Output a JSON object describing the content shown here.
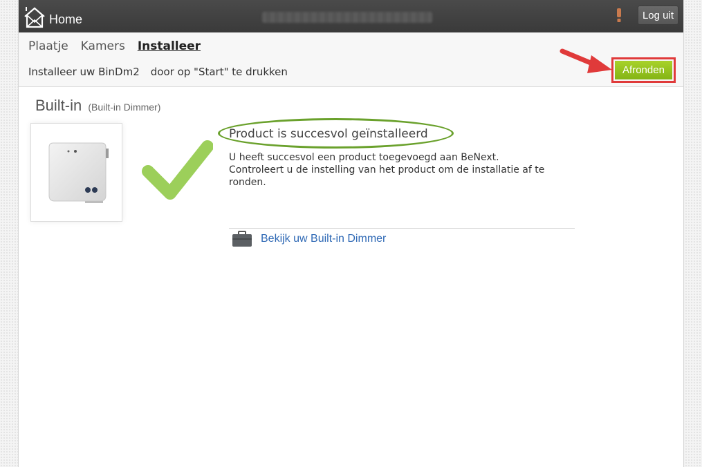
{
  "header": {
    "home_label": "Home",
    "home_icon": "home-icon",
    "alert_icon": "alert-icon",
    "logout_label": "Log uit"
  },
  "tabs": [
    {
      "label": "Plaatje",
      "active": false
    },
    {
      "label": "Kamers",
      "active": false
    },
    {
      "label": "Installeer",
      "active": true
    }
  ],
  "instruction": {
    "prefix": "Installeer uw ",
    "device": "BinDm2",
    "suffix": "door op \"Start\" te drukken"
  },
  "finish_label": "Afronden",
  "device": {
    "title": "Built-in",
    "subtitle": "(Built-in Dimmer)"
  },
  "success": {
    "title": "Product is succesvol geïnstalleerd",
    "line1": "U heeft succesvol een product toegevoegd aan BeNext.",
    "line2": "Controleert u de instelling van het product om de installatie af te ronden."
  },
  "view_link": {
    "label": "Bekijk uw Built-in Dimmer",
    "icon": "briefcase-icon"
  },
  "colors": {
    "topbar": "#3f3f3f",
    "accent_green": "#8fc31f",
    "highlight_red": "#e03a3a",
    "link_blue": "#2f69b5",
    "check_green": "#9ccf5a"
  }
}
